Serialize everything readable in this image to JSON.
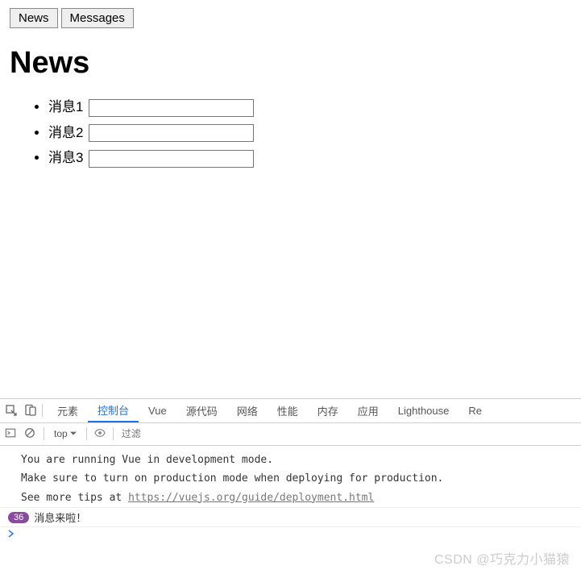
{
  "nav": {
    "buttons": [
      {
        "label": "News"
      },
      {
        "label": "Messages"
      }
    ]
  },
  "heading": "News",
  "messages": [
    {
      "label": "消息1",
      "value": ""
    },
    {
      "label": "消息2",
      "value": ""
    },
    {
      "label": "消息3",
      "value": ""
    }
  ],
  "devtools": {
    "tabs": {
      "elements": "元素",
      "console": "控制台",
      "vue": "Vue",
      "sources": "源代码",
      "network": "网络",
      "performance": "性能",
      "memory": "内存",
      "application": "应用",
      "lighthouse": "Lighthouse",
      "more": "Re"
    },
    "toolbar": {
      "context": "top",
      "filter_placeholder": "过滤"
    },
    "console": {
      "line1": "You are running Vue in development mode.",
      "line2": "Make sure to turn on production mode when deploying for production.",
      "line3_prefix": "See more tips at ",
      "line3_link": "https://vuejs.org/guide/deployment.html",
      "badge_count": "36",
      "log_message": "消息来啦！"
    }
  },
  "watermark": "CSDN @巧克力小猫猿"
}
